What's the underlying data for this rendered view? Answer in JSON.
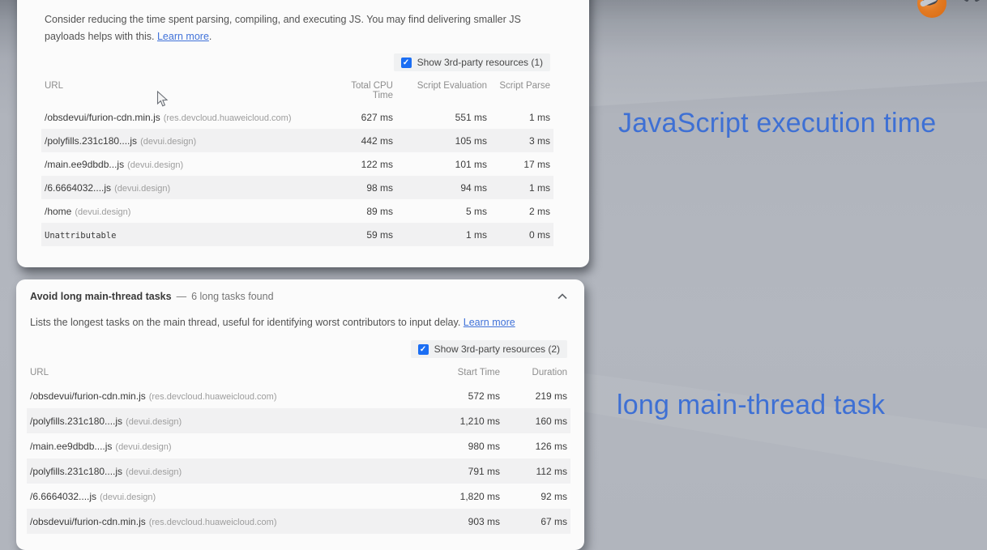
{
  "colors": {
    "accent_blue": "#1b6ef3",
    "annotation_blue": "#3e70d4",
    "logo_orange": "#dd6c15",
    "link_blue": "#4072d9"
  },
  "annotations": {
    "js_execution": "JavaScript execution time",
    "long_task": "long main-thread task"
  },
  "js_execution_panel": {
    "description": "Consider reducing the time spent parsing, compiling, and executing JS. You may find delivering smaller JS payloads helps with this. ",
    "learn_more": "Learn more",
    "description_suffix": ".",
    "third_party_checkbox": "Show 3rd-party resources (1)",
    "columns": [
      "URL",
      "Total CPU Time",
      "Script Evaluation",
      "Script Parse"
    ],
    "rows": [
      {
        "url": "/obsdevui/furion-cdn.min.js",
        "domain": "(res.devcloud.huaweicloud.com)",
        "total_cpu": "627 ms",
        "script_eval": "551 ms",
        "script_parse": "1 ms"
      },
      {
        "url": "/polyfills.231c180....js",
        "domain": "(devui.design)",
        "total_cpu": "442 ms",
        "script_eval": "105 ms",
        "script_parse": "3 ms"
      },
      {
        "url": "/main.ee9dbdb...js",
        "domain": "(devui.design)",
        "total_cpu": "122 ms",
        "script_eval": "101 ms",
        "script_parse": "17 ms"
      },
      {
        "url": "/6.6664032....js",
        "domain": "(devui.design)",
        "total_cpu": "98 ms",
        "script_eval": "94 ms",
        "script_parse": "1 ms"
      },
      {
        "url": "/home",
        "domain": "(devui.design)",
        "total_cpu": "89 ms",
        "script_eval": "5 ms",
        "script_parse": "2 ms"
      },
      {
        "url": "Unattributable",
        "domain": "",
        "total_cpu": "59 ms",
        "script_eval": "1 ms",
        "script_parse": "0 ms"
      }
    ]
  },
  "long_tasks_panel": {
    "title": "Avoid long main-thread tasks",
    "separator": "—",
    "subtitle": "6 long tasks found",
    "description": "Lists the longest tasks on the main thread, useful for identifying worst contributors to input delay. ",
    "learn_more": "Learn more",
    "third_party_checkbox": "Show 3rd-party resources (2)",
    "columns": [
      "URL",
      "Start Time",
      "Duration"
    ],
    "rows": [
      {
        "url": "/obsdevui/furion-cdn.min.js",
        "domain": "(res.devcloud.huaweicloud.com)",
        "start_time": "572 ms",
        "duration": "219 ms"
      },
      {
        "url": "/polyfills.231c180....js",
        "domain": "(devui.design)",
        "start_time": "1,210 ms",
        "duration": "160 ms"
      },
      {
        "url": "/main.ee9dbdb....js",
        "domain": "(devui.design)",
        "start_time": "980 ms",
        "duration": "126 ms"
      },
      {
        "url": "/polyfills.231c180....js",
        "domain": "(devui.design)",
        "start_time": "791 ms",
        "duration": "112 ms"
      },
      {
        "url": "/6.6664032....js",
        "domain": "(devui.design)",
        "start_time": "1,820 ms",
        "duration": "92 ms"
      },
      {
        "url": "/obsdevui/furion-cdn.min.js",
        "domain": "(res.devcloud.huaweicloud.com)",
        "start_time": "903 ms",
        "duration": "67 ms"
      }
    ]
  }
}
